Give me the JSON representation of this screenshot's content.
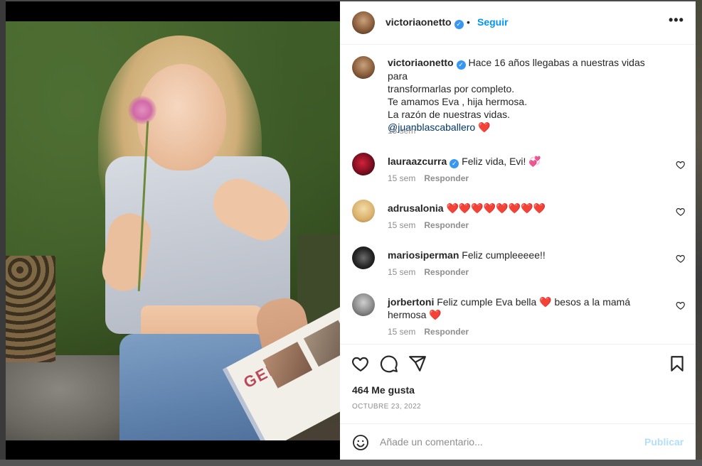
{
  "post": {
    "username": "victoriaonetto",
    "verified_mark": "✓",
    "dot": "•",
    "follow_label": "Seguir",
    "more_label": "•••",
    "caption": {
      "username": "victoriaonetto",
      "line1": "Hace 16 años llegabas a nuestras vidas para",
      "line2": "transformarlas por completo.",
      "line3": "Te amamos Eva , hija hermosa.",
      "line4": "La razón de nuestras vidas.",
      "mention": "@juanblascaballero",
      "emoji": "❤️",
      "time": "15 sem"
    },
    "comments": [
      {
        "username": "lauraazcurra",
        "verified": true,
        "text": "Feliz vida, Evi! 💞",
        "time": "15 sem",
        "reply": "Responder"
      },
      {
        "username": "adrusalonia",
        "verified": false,
        "text": "❤️❤️❤️❤️❤️❤️❤️❤️",
        "time": "15 sem",
        "reply": "Responder"
      },
      {
        "username": "mariosiperman",
        "verified": false,
        "text": "Feliz cumpleeeee!!",
        "time": "15 sem",
        "reply": "Responder"
      },
      {
        "username": "jorbertoni",
        "verified": false,
        "text_part1": "Feliz cumple Eva bella",
        "text_heart": "❤️",
        "text_part2": "besos a la mamá",
        "text_line2": "hermosa",
        "text_heart2": "❤️",
        "time": "15 sem",
        "reply": "Responder"
      }
    ],
    "likes": "464 Me gusta",
    "date": "OCTUBRE 23, 2022",
    "comment_placeholder": "Añade un comentario...",
    "publish_label": "Publicar",
    "photo_album_text": "GELI"
  },
  "icons": {
    "like": "heart-icon",
    "comment": "comment-icon",
    "share": "share-icon",
    "save": "bookmark-icon",
    "emoji": "emoji-icon"
  },
  "colors": {
    "link_blue": "#0095f6",
    "verified_blue": "#3897f0",
    "publish_disabled": "#b2dffc",
    "heart_red": "#ed4956"
  }
}
